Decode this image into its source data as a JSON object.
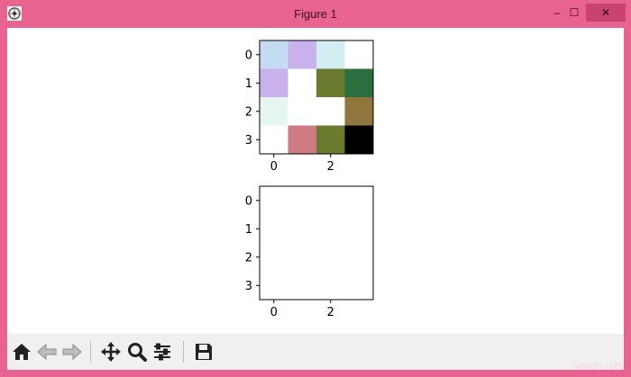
{
  "window": {
    "title": "Figure 1",
    "minimize_glyph": "–",
    "maximize_glyph": "☐",
    "close_glyph": "✕",
    "app_icon": "matplotlib-figure-icon"
  },
  "toolbar": {
    "buttons": [
      {
        "name": "home-button",
        "icon": "home-icon"
      },
      {
        "name": "back-button",
        "icon": "arrow-left-icon"
      },
      {
        "name": "forward-button",
        "icon": "arrow-right-icon"
      },
      {
        "name": "pan-button",
        "icon": "move-icon"
      },
      {
        "name": "zoom-button",
        "icon": "magnifier-icon"
      },
      {
        "name": "configure-subplots-button",
        "icon": "sliders-icon"
      },
      {
        "name": "save-button",
        "icon": "floppy-disk-icon"
      }
    ]
  },
  "watermark": "wsxdn.com",
  "chart_data": [
    {
      "type": "heatmap",
      "title": "",
      "xlabel": "",
      "ylabel": "",
      "x_ticks": [
        "0",
        "2"
      ],
      "y_ticks": [
        "0",
        "1",
        "2",
        "3"
      ],
      "cell_colors": [
        [
          "#c4dbf3",
          "#c9b2ec",
          "#d3eef2",
          "#ffffff"
        ],
        [
          "#c9b2ec",
          "#ffffff",
          "#6a7a2e",
          "#2b6f3f"
        ],
        [
          "#e5f5f0",
          "#ffffff",
          "#ffffff",
          "#8f763d"
        ],
        [
          "#ffffff",
          "#cd7c83",
          "#6a7a2e",
          "#000000"
        ]
      ]
    },
    {
      "type": "heatmap",
      "title": "",
      "xlabel": "",
      "ylabel": "",
      "x_ticks": [
        "0",
        "2"
      ],
      "y_ticks": [
        "0",
        "1",
        "2",
        "3"
      ],
      "cell_colors": []
    }
  ]
}
